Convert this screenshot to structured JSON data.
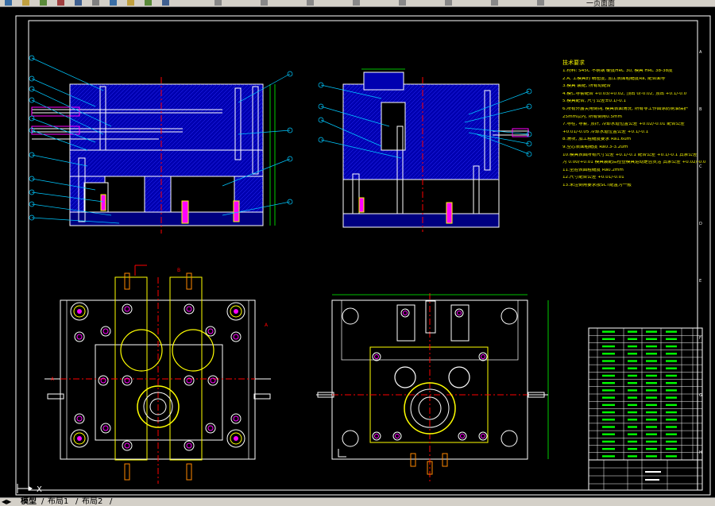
{
  "window": {
    "title_fragment": "一页面面"
  },
  "toolbar": {
    "icons": [
      "save-icon",
      "open-icon",
      "print-icon",
      "undo-icon",
      "redo-icon",
      "zoom-icon",
      "pan-icon",
      "properties-icon",
      "layer-icon",
      "help-icon"
    ]
  },
  "tabs": {
    "items": [
      {
        "label": "模型"
      },
      {
        "label": "布局1"
      },
      {
        "label": "布局2"
      }
    ],
    "separator": "/",
    "active_index": 0
  },
  "drawing": {
    "notes_title": "技术要求",
    "notes": [
      "1.材料: S45C 不锈钢 硬度HRC 30, 模具 HRC 38-38度",
      "2.A, 工模具的 精密度, 加工表面粗糙度Ra, 配合面等",
      "3.模具 装配, 所有动配合",
      "4.模仁导套配合 +0.03/+0.02, 顶出 0/-0.02, 顶出 +0.1/-0.0",
      "5.模具配合, 尺寸公差±0.1/-0.1",
      "6.所有外露尖角倒钝, 模具表面清洗, 所有非工作面涂防锈油保护",
      "  25mm以内, 所有倒角0.5mm",
      "7.导柱, 导套, 顶针, 冷却水道位置公差 +0.02/-0.01 配合公差",
      "  +0.01/-0.05 冷却水道位置公差 +0.1/-0.1",
      "8.滑块, 加工粗糙度要求 Ra1.6um",
      "9.型芯表面粗糙度 Ra0.3-3.2um",
      "10.模具表面所有尺寸公差 +0.1/-0.1 配合公差 +0.1/-0.1 其余公差",
      "   为 0.00/+0.01 模具装配后检查模具运动是否灵活 其余公差 +0.02/-0.01",
      "11.型腔表面粗糙度 Ra0.2mm",
      "12.尺寸配合公差 +0.01/-0.01",
      "13.未注倒角要求按SCT配置为一般"
    ],
    "bom_row_count": 18,
    "colors": {
      "background": "#000000",
      "frame": "#ffffff",
      "hatch": "#0000c8",
      "outline": "#ffffff",
      "centerline": "#ff0000",
      "leader": "#00c8ff",
      "yellow": "#ffff00",
      "magenta": "#ff00ff",
      "green": "#00ff00",
      "cyan": "#00ffff"
    },
    "axis_letters": [
      "A",
      "B",
      "C",
      "D",
      "E",
      "F",
      "G",
      "H"
    ],
    "view_markers": [
      "A",
      "B",
      "B",
      "A"
    ],
    "ucs_label": "X"
  }
}
